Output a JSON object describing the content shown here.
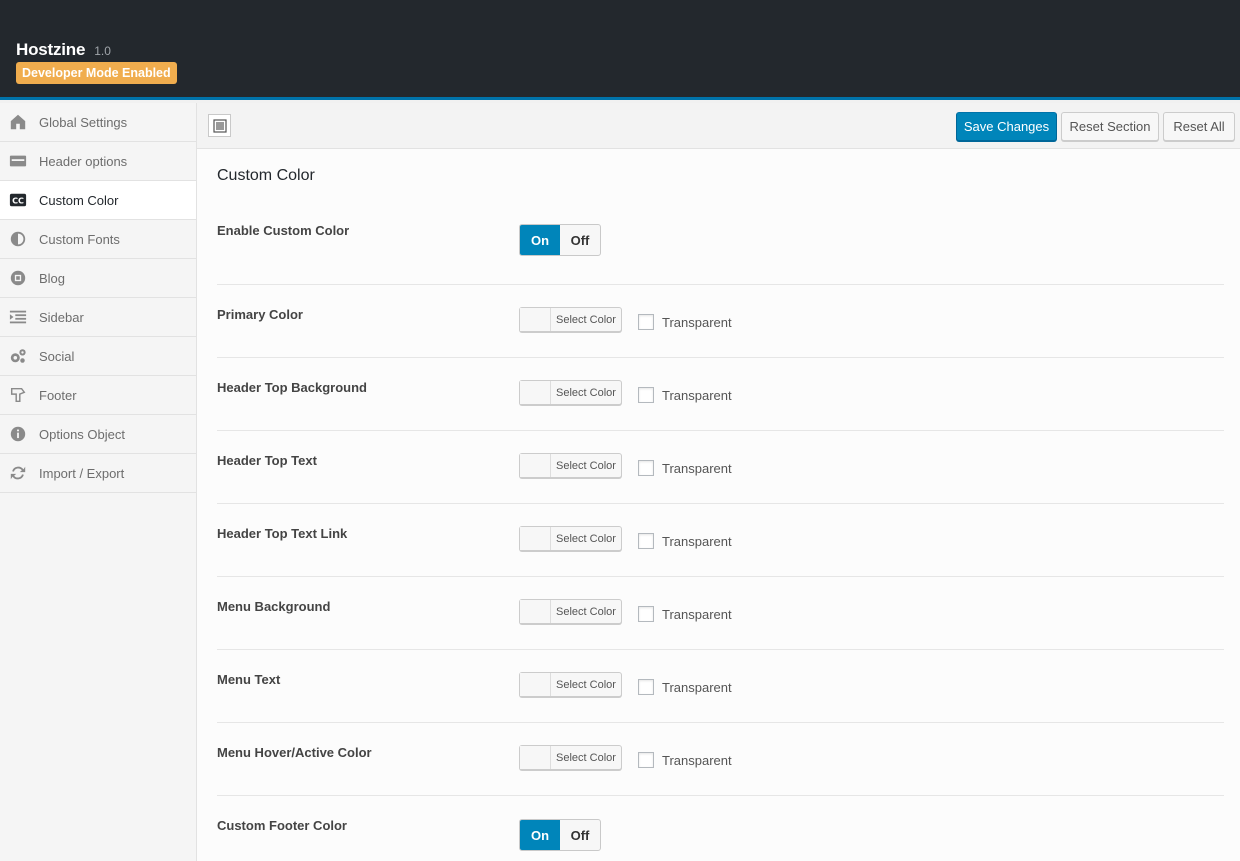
{
  "header": {
    "app_name": "Hostzine",
    "version": "1.0",
    "dev_badge": "Developer Mode Enabled"
  },
  "sidebar": {
    "items": [
      {
        "label": "Global Settings",
        "icon": "home-icon"
      },
      {
        "label": "Header options",
        "icon": "header-icon"
      },
      {
        "label": "Custom Color",
        "icon": "cc-icon",
        "active": true
      },
      {
        "label": "Custom Fonts",
        "icon": "contrast-icon"
      },
      {
        "label": "Blog",
        "icon": "blog-icon"
      },
      {
        "label": "Sidebar",
        "icon": "sidebar-icon"
      },
      {
        "label": "Social",
        "icon": "cogs-icon"
      },
      {
        "label": "Footer",
        "icon": "hand-icon"
      },
      {
        "label": "Options Object",
        "icon": "info-icon"
      },
      {
        "label": "Import / Export",
        "icon": "refresh-icon"
      }
    ]
  },
  "toolbar": {
    "save_label": "Save Changes",
    "reset_section_label": "Reset Section",
    "reset_all_label": "Reset All"
  },
  "section": {
    "title": "Custom Color",
    "switch_on": "On",
    "switch_off": "Off",
    "select_color": "Select Color",
    "transparent": "Transparent",
    "enable_label": "Enable Custom Color",
    "color_rows": [
      "Primary Color",
      "Header Top Background",
      "Header Top Text",
      "Header Top Text Link",
      "Menu Background",
      "Menu Text",
      "Menu Hover/Active Color"
    ],
    "footer_label": "Custom Footer Color"
  },
  "colors": {
    "accent": "#0085ba",
    "header_bg": "#23282d",
    "badge": "#f0ad4e"
  }
}
